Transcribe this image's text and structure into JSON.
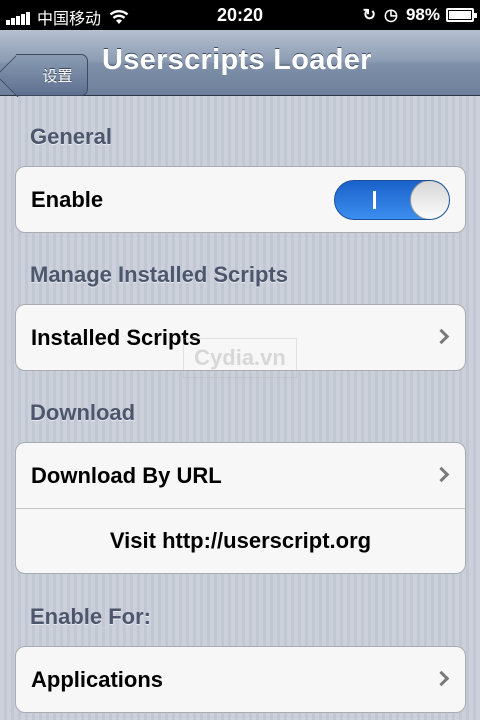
{
  "status_bar": {
    "carrier": "中国移动",
    "time": "20:20",
    "battery": "98%",
    "battery_level": 0.98,
    "icons": [
      "signal-icon",
      "wifi-icon",
      "rotation-lock-icon",
      "alarm-icon",
      "battery-icon"
    ]
  },
  "nav": {
    "back_label": "设置",
    "title": "Userscripts Loader"
  },
  "sections": {
    "general": {
      "header": "General",
      "enable_label": "Enable",
      "enable_on": true,
      "toggle_color": "#2a78e4"
    },
    "manage": {
      "header": "Manage Installed Scripts",
      "installed_label": "Installed Scripts"
    },
    "download": {
      "header": "Download",
      "by_url_label": "Download By URL",
      "visit_label": "Visit http://userscript.org"
    },
    "enable_for": {
      "header": "Enable For:",
      "applications_label": "Applications"
    }
  },
  "watermark": "Cydia.vn"
}
